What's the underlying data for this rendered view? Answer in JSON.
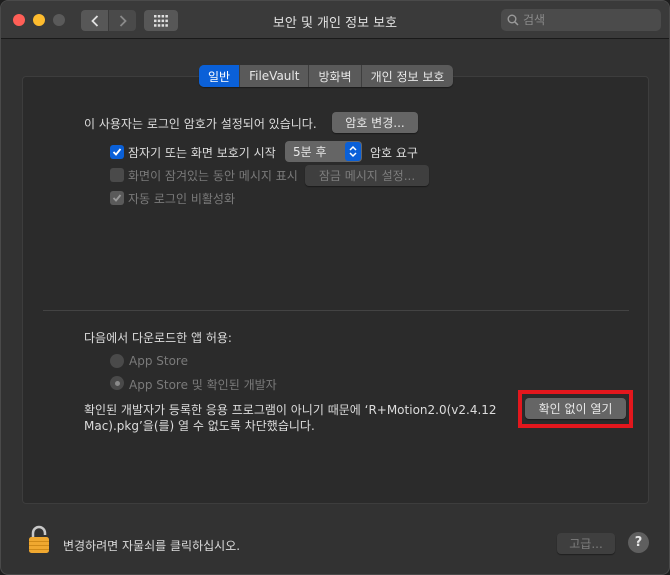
{
  "window": {
    "title": "보안 및 개인 정보 보호",
    "search_placeholder": "검색"
  },
  "tabs": [
    {
      "label": "일반",
      "active": true
    },
    {
      "label": "FileVault",
      "active": false
    },
    {
      "label": "방화벽",
      "active": false
    },
    {
      "label": "개인 정보 보호",
      "active": false
    }
  ],
  "general": {
    "password_text": "이 사용자는 로그인 암호가 설정되어 있습니다.",
    "change_password_button": "암호 변경...",
    "require_password_label": "잠자기 또는 화면 보호기 시작",
    "require_password_checked": true,
    "require_password_delay": "5분 후",
    "require_password_suffix": "암호 요구",
    "lock_message_label": "화면이 잠겨있는 동안 메시지 표시",
    "lock_message_checked": false,
    "lock_message_button": "잠금 메시지 설정...",
    "disable_autologin_label": "자동 로그인 비활성화",
    "disable_autologin_checked": true
  },
  "downloads": {
    "heading": "다음에서 다운로드한 앱 허용:",
    "option_app_store": "App Store",
    "option_app_store_devs": "App Store 및 확인된 개발자",
    "selected_option": "App Store 및 확인된 개발자",
    "blocked_message_line1": "확인된 개발자가 등록한 응용 프로그램이 아니기 때문에 ‘R+Motion2.0(v2.4.12",
    "blocked_message_line2": "Mac).pkg’을(를) 열 수 없도록 차단했습니다.",
    "open_anyway_button": "확인 없이 열기"
  },
  "footer": {
    "lock_text": "변경하려면 자물쇠를 클릭하십시오.",
    "advanced_button": "고급...",
    "help_button": "?"
  },
  "colors": {
    "accent": "#0a60d8",
    "highlight": "#e3171d",
    "lock": "#f0a830"
  }
}
